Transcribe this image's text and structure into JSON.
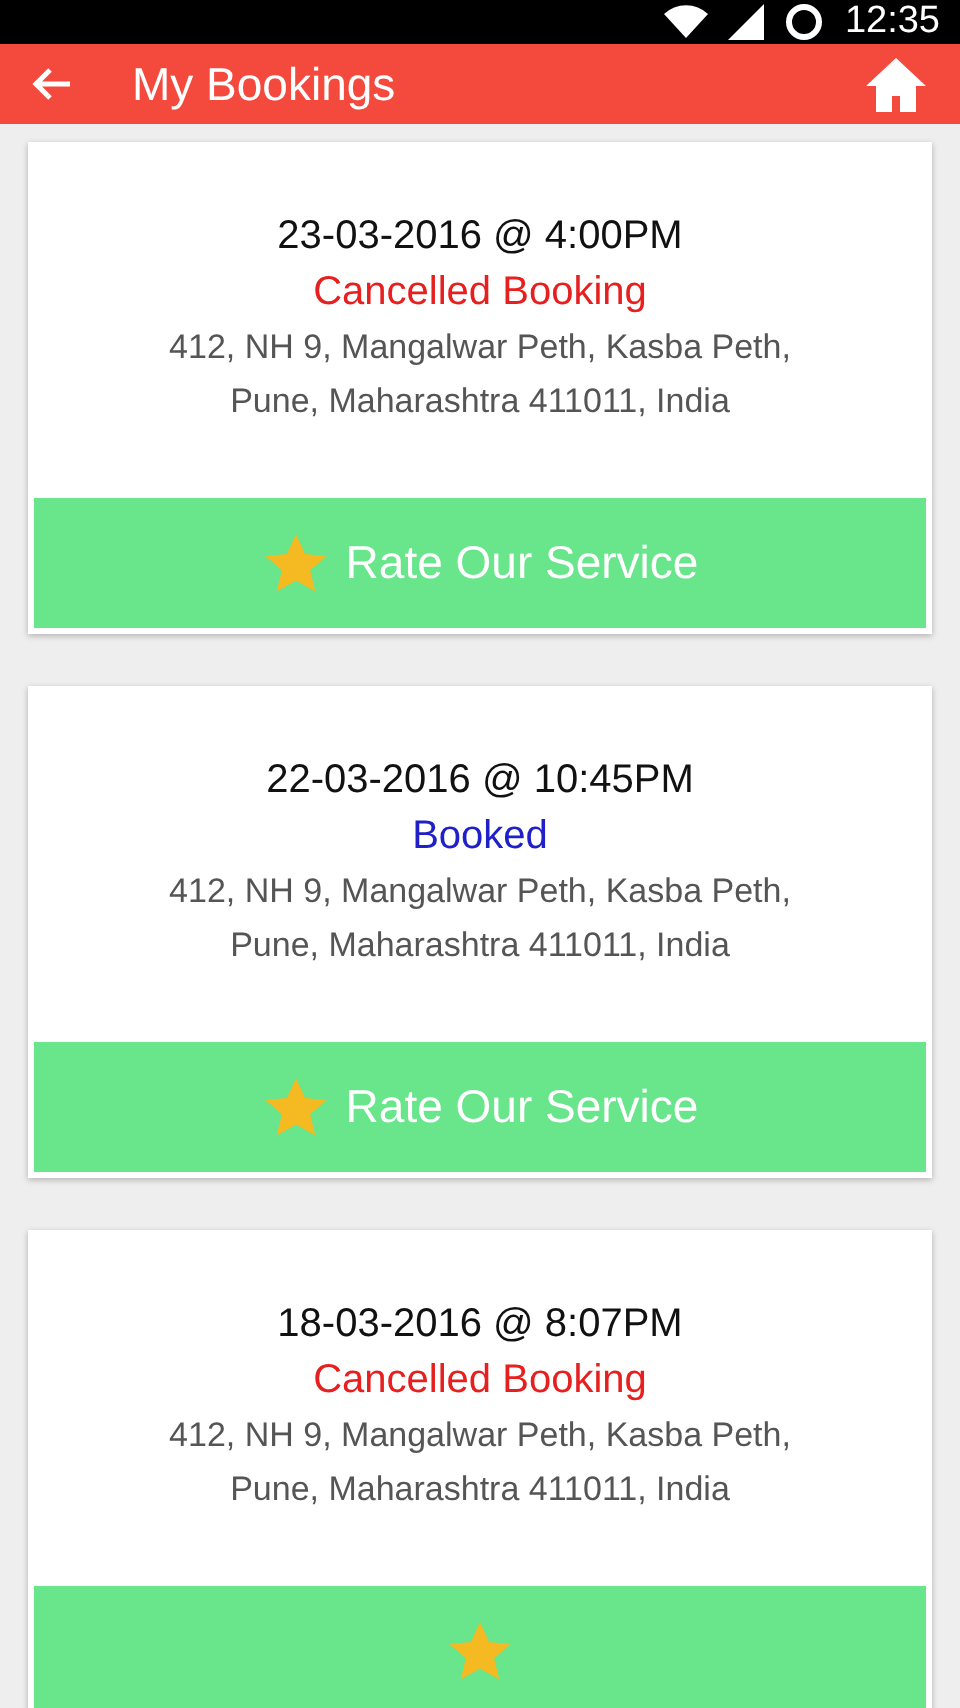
{
  "status_bar": {
    "time": "12:35"
  },
  "app_bar": {
    "title": "My Bookings"
  },
  "bookings": [
    {
      "datetime": "23-03-2016 @ 4:00PM",
      "status": "Cancelled Booking",
      "kind": "cancelled",
      "address": "412, NH 9, Mangalwar Peth, Kasba Peth, Pune, Maharashtra 411011, India",
      "action": "Rate Our Service"
    },
    {
      "datetime": "22-03-2016 @ 10:45PM",
      "status": "Booked",
      "kind": "booked",
      "address": "412, NH 9, Mangalwar Peth, Kasba Peth, Pune, Maharashtra 411011, India",
      "action": "Rate Our Service"
    },
    {
      "datetime": "18-03-2016 @ 8:07PM",
      "status": "Cancelled Booking",
      "kind": "cancelled",
      "address": "412, NH 9, Mangalwar Peth, Kasba Peth, Pune, Maharashtra 411011, India"
    }
  ]
}
